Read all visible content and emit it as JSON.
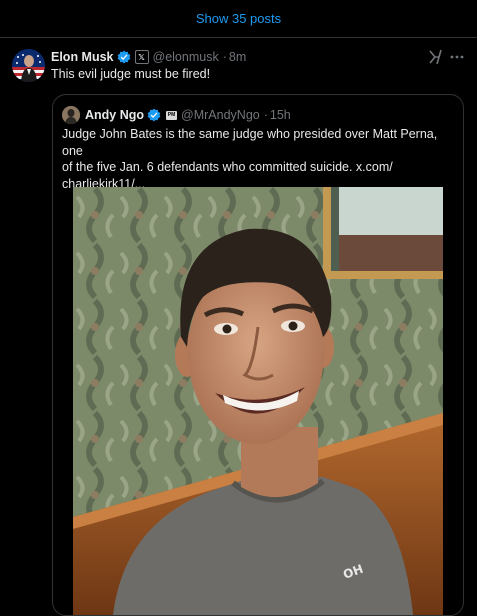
{
  "show_posts": {
    "label": "Show 35 posts"
  },
  "tweet": {
    "author_name": "Elon Musk",
    "author_handle": "@elonmusk",
    "time": "8m",
    "text": "This evil judge must be fired!",
    "affiliate_badge": "𝕏"
  },
  "quoted": {
    "author_name": "Andy Ngo",
    "author_handle": "@MrAndyNgo",
    "time": "15h",
    "text_lines": [
      "Judge John Bates is the same judge who presided over Matt Perna, one",
      "of the five Jan. 6 defendants who committed suicide.  x.com/",
      "charliekirk11/..."
    ],
    "affiliate_badge": "PM",
    "shirt_text": "OH"
  },
  "icons": {
    "verified": "verified-badge-icon",
    "grok": "grok-icon",
    "more": "more-options-icon"
  },
  "colors": {
    "background": "#000000",
    "accent": "#1d9bf0",
    "muted": "#71767b",
    "border": "#2f3336"
  }
}
